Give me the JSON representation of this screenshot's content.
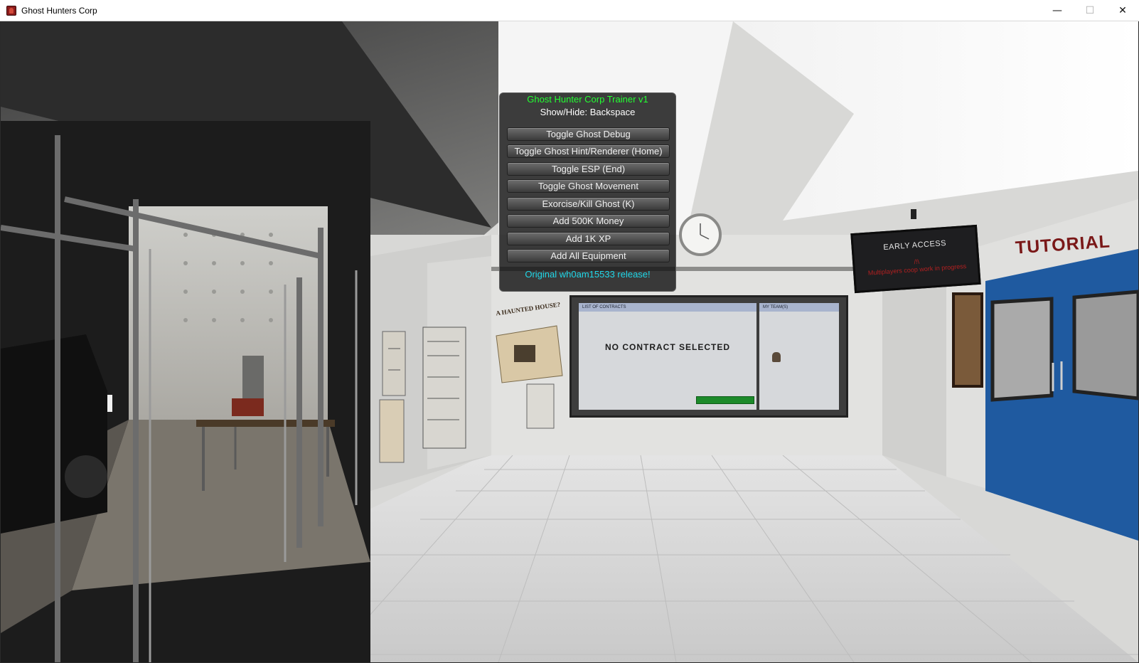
{
  "window": {
    "title": "Ghost Hunters Corp",
    "icon": "ghost-hunters-app-icon",
    "controls": {
      "minimize": "—",
      "maximize": "☐",
      "close": "✕"
    }
  },
  "trainer": {
    "title": "Ghost Hunter Corp Trainer v1",
    "hint": "Show/Hide: Backspace",
    "buttons": [
      "Toggle Ghost Debug",
      "Toggle Ghost Hint/Renderer (Home)",
      "Toggle ESP (End)",
      "Toggle Ghost Movement",
      "Exorcise/Kill Ghost (K)",
      "Add 500K Money",
      "Add 1K XP",
      "Add All Equipment"
    ],
    "footer": "Original wh0am15533 release!",
    "colors": {
      "title": "#23ff32",
      "footer": "#20d7e8"
    }
  },
  "scene": {
    "contract_board": {
      "contracts_header": "LIST OF CONTRACTS",
      "team_header": "MY TEAM(S)",
      "status": "NO CONTRACT SELECTED"
    },
    "early_access_sign": {
      "title": "EARLY ACCESS",
      "warning_icon": "/!\\",
      "subtitle": "Multiplayers coop work in progress"
    },
    "tutorial_sign": "TUTORIAL",
    "poster": "A HAUNTED HOUSE?"
  }
}
